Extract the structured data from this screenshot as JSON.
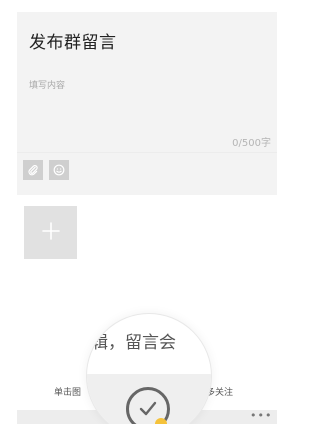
{
  "compose": {
    "title": "发布群留言",
    "placeholder": "填写内容",
    "counter": "0/500字"
  },
  "toolbar": {
    "attach_icon": "attach-icon",
    "emoji_icon": "emoji-icon"
  },
  "upload": {
    "add_icon": "plus-icon"
  },
  "magnifier": {
    "text": "辑，留言会"
  },
  "footer": {
    "left_text": "单击图",
    "right_text": "多关注",
    "more": "•••"
  },
  "colors": {
    "card_bg": "#f3f3f3",
    "tool_bg": "#cfcfcf",
    "add_bg": "#e1e1e1",
    "badge": "#f5c23a"
  }
}
